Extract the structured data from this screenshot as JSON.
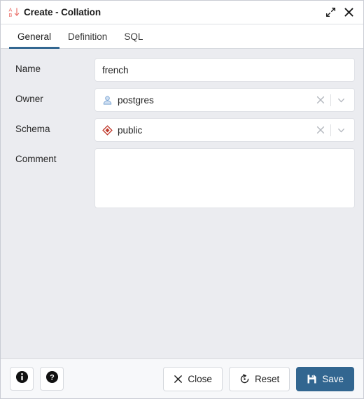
{
  "window": {
    "title": "Create - Collation",
    "title_icon": "sort-alpha-down-icon",
    "expand_label": "Expand",
    "close_label": "Close window",
    "accent_color": "#336791",
    "primary_button_color": "#326690",
    "icon_red": "#e8635d",
    "schema_icon_color": "#c0392b",
    "owner_icon_color": "#a8c6e8"
  },
  "tabs": [
    {
      "label": "General",
      "active": true
    },
    {
      "label": "Definition",
      "active": false
    },
    {
      "label": "SQL",
      "active": false
    }
  ],
  "form": {
    "name": {
      "label": "Name",
      "value": "french",
      "placeholder": ""
    },
    "owner": {
      "label": "Owner",
      "value": "postgres",
      "icon": "user-icon",
      "clear_label": "Clear",
      "dropdown_label": "Open dropdown"
    },
    "schema": {
      "label": "Schema",
      "value": "public",
      "icon": "schema-diamond-icon",
      "clear_label": "Clear",
      "dropdown_label": "Open dropdown"
    },
    "comment": {
      "label": "Comment",
      "value": "",
      "placeholder": ""
    }
  },
  "footer": {
    "info_label": "Information",
    "help_label": "Help",
    "close": {
      "label": "Close",
      "icon": "close-x-icon"
    },
    "reset": {
      "label": "Reset",
      "icon": "reset-rotate-icon"
    },
    "save": {
      "label": "Save",
      "icon": "save-floppy-icon"
    }
  }
}
